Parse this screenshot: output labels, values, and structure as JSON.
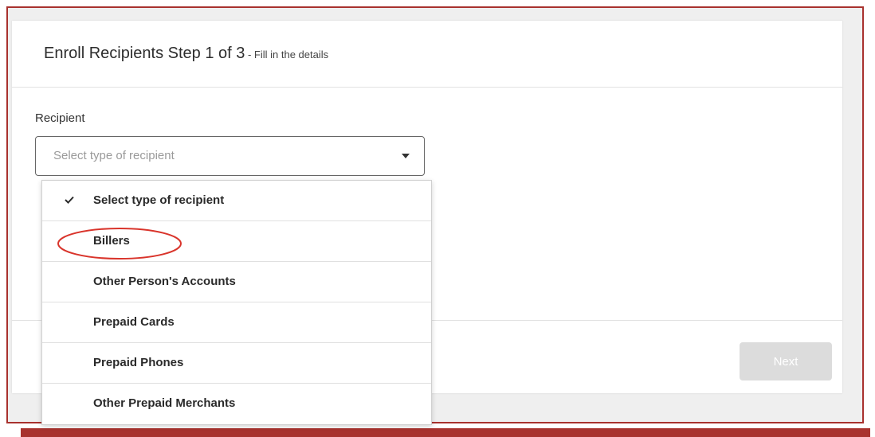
{
  "form": {
    "title": "Enroll Recipients Step 1 of 3",
    "subtitle": " - Fill in the details",
    "recipient_label": "Recipient",
    "select_placeholder": "Select type of recipient",
    "next_label": "Next"
  },
  "dropdown": {
    "options": [
      {
        "label": "Select type of recipient",
        "selected": true
      },
      {
        "label": "Billers",
        "selected": false,
        "highlighted": true
      },
      {
        "label": "Other Person's Accounts",
        "selected": false
      },
      {
        "label": "Prepaid Cards",
        "selected": false
      },
      {
        "label": "Prepaid Phones",
        "selected": false
      },
      {
        "label": "Other Prepaid Merchants",
        "selected": false
      }
    ]
  },
  "icons": {
    "selected_check": "check-icon",
    "select_caret": "caret-down-icon"
  },
  "colors": {
    "frame_border": "#a8322e",
    "highlight_ellipse": "#d9342b",
    "disabled_button": "#dcdcdc"
  }
}
